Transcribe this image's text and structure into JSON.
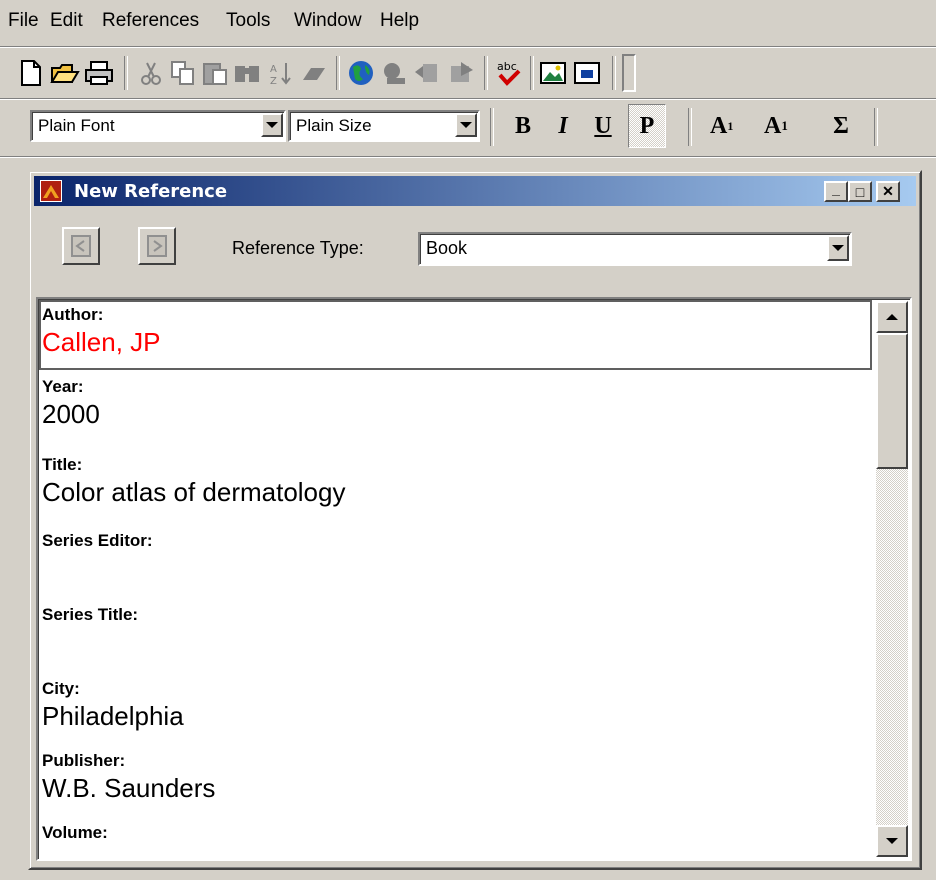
{
  "menu": {
    "items": [
      {
        "label": "File"
      },
      {
        "label": "Edit"
      },
      {
        "label": "References"
      },
      {
        "label": "Tools"
      },
      {
        "label": "Window"
      },
      {
        "label": "Help"
      }
    ]
  },
  "format_toolbar": {
    "font_value": "Plain Font",
    "size_value": "Plain Size",
    "bold": "B",
    "italic": "I",
    "underline": "U",
    "plain": "P",
    "superscript_base": "A",
    "superscript_mark": "1",
    "subscript_base": "A",
    "subscript_mark": "1",
    "symbol": "Σ"
  },
  "window": {
    "title": "New Reference",
    "minimize": "_",
    "maximize": "□",
    "close": "✕",
    "reference_type_label": "Reference Type:",
    "reference_type_value": "Book"
  },
  "fields": [
    {
      "label": "Author:",
      "value": "Callen, JP"
    },
    {
      "label": "Year:",
      "value": "2000"
    },
    {
      "label": "Title:",
      "value": "Color atlas of dermatology"
    },
    {
      "label": "Series Editor:",
      "value": ""
    },
    {
      "label": "Series Title:",
      "value": ""
    },
    {
      "label": "City:",
      "value": "Philadelphia"
    },
    {
      "label": "Publisher:",
      "value": "W.B. Saunders"
    },
    {
      "label": "Volume:",
      "value": ""
    }
  ],
  "colors": {
    "author_value": "#ff0000",
    "titlebar_start": "#0a246a",
    "titlebar_end": "#a6caf0"
  },
  "icons": [
    "new-document-icon",
    "open-folder-icon",
    "print-icon",
    "cut-icon",
    "copy-icon",
    "paste-icon",
    "find-icon",
    "sort-icon",
    "eraser-icon",
    "globe-icon",
    "search-online-icon",
    "insert-citation-icon",
    "format-bibliography-icon",
    "spellcheck-icon",
    "insert-picture-icon",
    "insert-object-icon"
  ]
}
